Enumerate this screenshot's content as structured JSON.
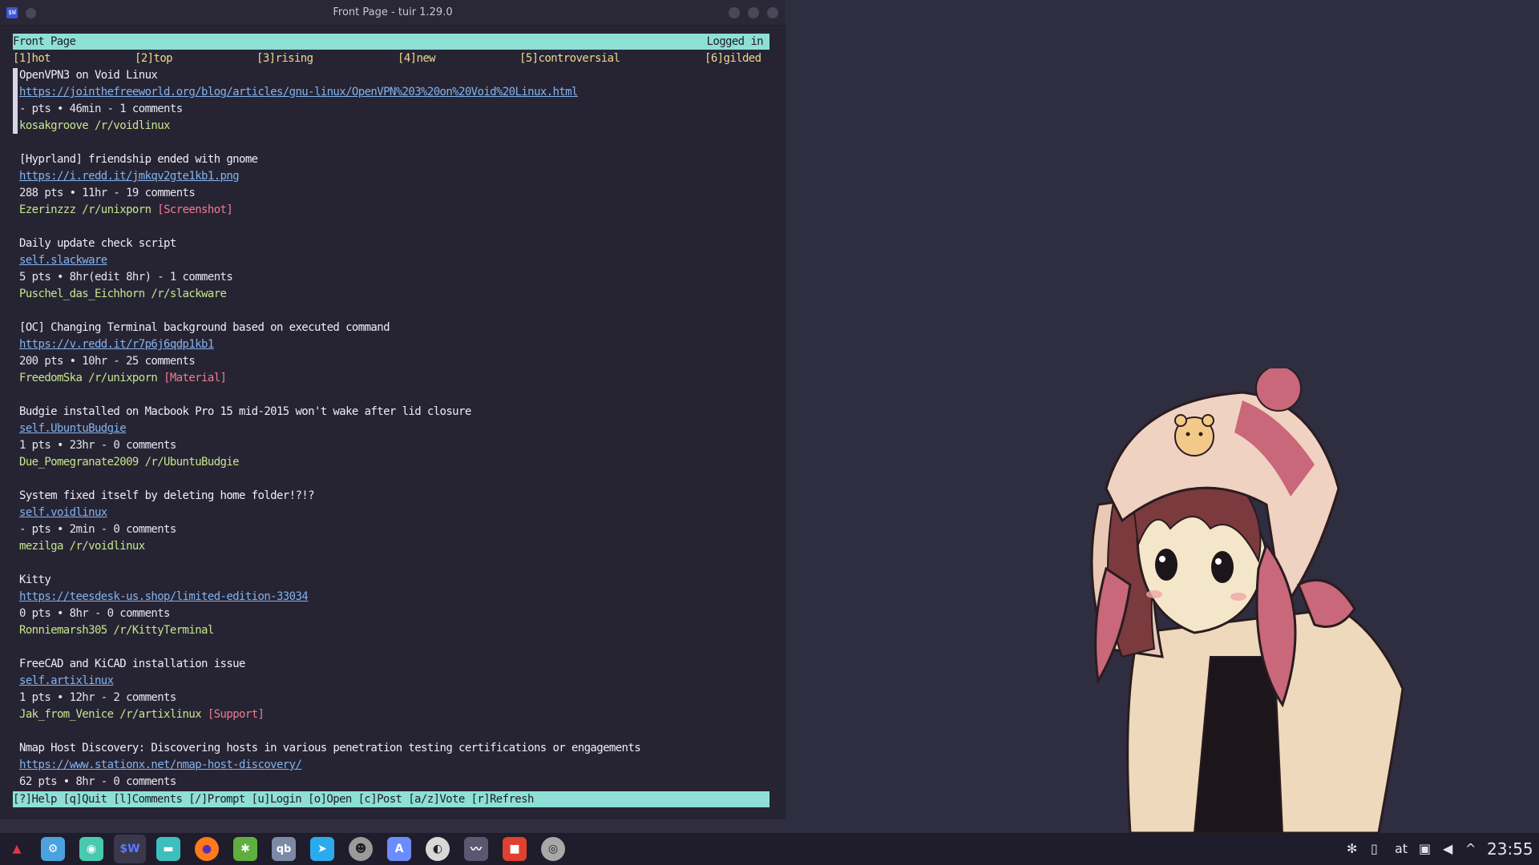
{
  "window": {
    "title": "Front Page - tuir 1.29.0"
  },
  "header": {
    "left": "Front Page",
    "right": "Logged in"
  },
  "tabs": [
    {
      "label": "[1]hot"
    },
    {
      "label": "[2]top"
    },
    {
      "label": "[3]rising"
    },
    {
      "label": "[4]new"
    },
    {
      "label": "[5]controversial"
    },
    {
      "label": "[6]gilded"
    }
  ],
  "posts": [
    {
      "title": "OpenVPN3 on Void Linux",
      "link": "https://jointhefreeworld.org/blog/articles/gnu-linux/OpenVPN%203%20on%20Void%20Linux.html",
      "meta": "- pts • 46min - 1 comments",
      "author": "kosakgroove /r/voidlinux",
      "flair": ""
    },
    {
      "title": "[Hyprland] friendship ended with gnome",
      "link": "https://i.redd.it/jmkqv2gte1kb1.png",
      "meta": "288 pts • 11hr - 19 comments",
      "author": "Ezerinzzz /r/unixporn",
      "flair": "[Screenshot]"
    },
    {
      "title": "Daily update check script",
      "link": "self.slackware",
      "meta": "5 pts • 8hr(edit 8hr) - 1 comments",
      "author": "Puschel_das_Eichhorn /r/slackware",
      "flair": ""
    },
    {
      "title": "[OC] Changing Terminal background based on executed command",
      "link": "https://v.redd.it/r7p6j6qdp1kb1",
      "meta": "200 pts • 10hr - 25 comments",
      "author": "FreedomSka /r/unixporn",
      "flair": "[Material]"
    },
    {
      "title": "Budgie installed on Macbook Pro 15 mid-2015 won't wake after lid closure",
      "link": "self.UbuntuBudgie",
      "meta": "1 pts • 23hr - 0 comments",
      "author": "Due_Pomegranate2009 /r/UbuntuBudgie",
      "flair": ""
    },
    {
      "title": "System fixed itself by deleting home folder!?!?",
      "link": "self.voidlinux",
      "meta": "- pts • 2min - 0 comments",
      "author": "mezilga /r/voidlinux",
      "flair": ""
    },
    {
      "title": "Kitty",
      "link": "https://teesdesk-us.shop/limited-edition-33034",
      "meta": "0 pts • 8hr - 0 comments",
      "author": "Ronniemarsh305 /r/KittyTerminal",
      "flair": ""
    },
    {
      "title": "FreeCAD and KiCAD installation issue",
      "link": "self.artixlinux",
      "meta": "1 pts • 12hr - 2 comments",
      "author": "Jak_from_Venice /r/artixlinux",
      "flair": "[Support]"
    },
    {
      "title": "Nmap Host Discovery: Discovering hosts in various penetration testing certifications or engagements",
      "link": "https://www.stationx.net/nmap-host-discovery/",
      "meta": "62 pts • 8hr - 0 comments",
      "author": "",
      "flair": ""
    }
  ],
  "footer": "[?]Help [q]Quit [l]Comments [/]Prompt [u]Login [o]Open [c]Post [a/z]Vote [r]Refresh",
  "taskbar": {
    "apps": [
      {
        "name": "launcher-icon",
        "glyph": "▲",
        "color": "#e2354b"
      },
      {
        "name": "settings-icon",
        "glyph": "⚙",
        "color": "#4aa3df"
      },
      {
        "name": "discord-icon",
        "glyph": "◉",
        "color": "#48c9b0"
      },
      {
        "name": "terminal-icon",
        "glyph": "$W",
        "color": "#3a56d4"
      },
      {
        "name": "files-icon",
        "glyph": "▬",
        "color": "#3dbfbf"
      },
      {
        "name": "firefox-icon",
        "glyph": "●",
        "color": "#ff7a1a"
      },
      {
        "name": "tool-icon",
        "glyph": "✱",
        "color": "#5fae3e"
      },
      {
        "name": "qbittorrent-icon",
        "glyph": "qb",
        "color": "#7d8aa6"
      },
      {
        "name": "telegram-icon",
        "glyph": "➤",
        "color": "#2aabee"
      },
      {
        "name": "gimp-icon",
        "glyph": "☻",
        "color": "#9a9a9a"
      },
      {
        "name": "appimage-icon",
        "glyph": "A",
        "color": "#6b8cff"
      },
      {
        "name": "audio-icon",
        "glyph": "◐",
        "color": "#d8d8d8"
      },
      {
        "name": "monitor-icon",
        "glyph": "〰",
        "color": "#5a5870"
      },
      {
        "name": "recorder-icon",
        "glyph": "■",
        "color": "#e0402f"
      },
      {
        "name": "camera-icon",
        "glyph": "◎",
        "color": "#a8a8a8"
      }
    ],
    "tray": {
      "keyboard": "at",
      "clock": "23:55"
    }
  },
  "colors": {
    "accent_bar": "#8ee0d6",
    "tab_text": "#f0d98c",
    "link": "#83b3ee",
    "author": "#c7e58c",
    "flair": "#f07b8e",
    "background": "#262433"
  }
}
